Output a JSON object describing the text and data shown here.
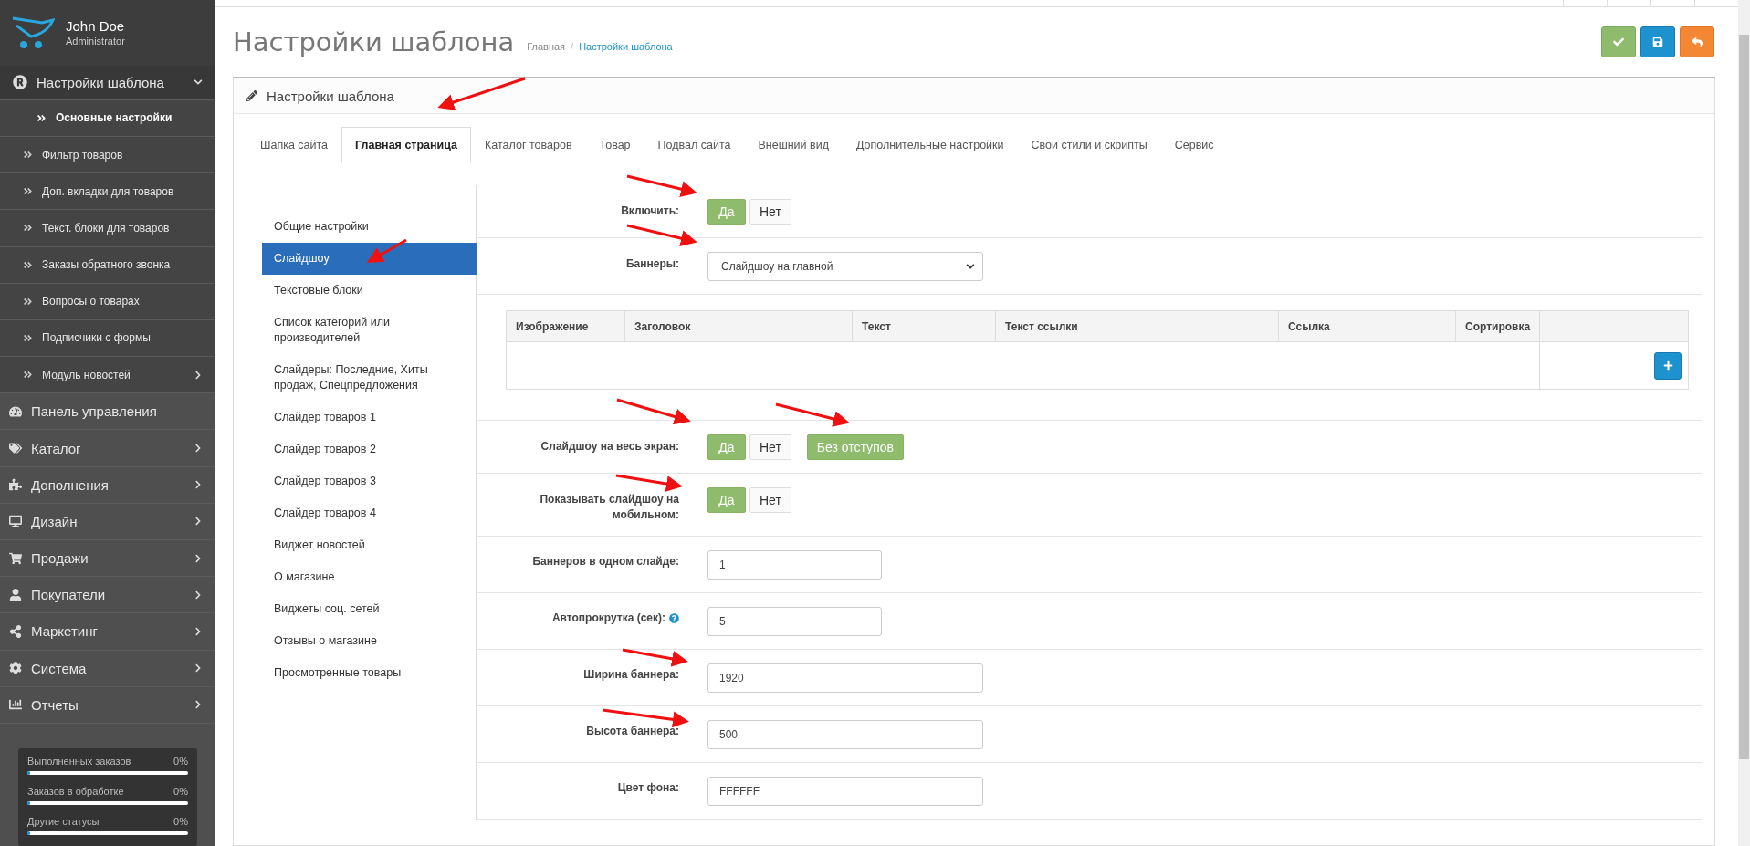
{
  "user": {
    "name": "John Doe",
    "role": "Administrator"
  },
  "sidebar": {
    "items": [
      {
        "label": "Настройки шаблона",
        "expandable": true,
        "expanded": true,
        "children": [
          {
            "label": "Основные настройки",
            "selected": true,
            "expandable": false
          },
          {
            "label": "Фильтр товаров",
            "selected": false,
            "expandable": false
          },
          {
            "label": "Доп. вкладки для товаров",
            "selected": false,
            "expandable": false
          },
          {
            "label": "Текст. блоки для товаров",
            "selected": false,
            "expandable": false
          },
          {
            "label": "Заказы обратного звонка",
            "selected": false,
            "expandable": false
          },
          {
            "label": "Вопросы о товарах",
            "selected": false,
            "expandable": false
          },
          {
            "label": "Подписчики с формы",
            "selected": false,
            "expandable": false
          },
          {
            "label": "Модуль новостей",
            "selected": false,
            "expandable": true
          }
        ]
      },
      {
        "label": "Панель управления",
        "expandable": false,
        "expanded": false
      },
      {
        "label": "Каталог",
        "expandable": true,
        "expanded": false
      },
      {
        "label": "Дополнения",
        "expandable": true,
        "expanded": false
      },
      {
        "label": "Дизайн",
        "expandable": true,
        "expanded": false
      },
      {
        "label": "Продажи",
        "expandable": true,
        "expanded": false
      },
      {
        "label": "Покупатели",
        "expandable": true,
        "expanded": false
      },
      {
        "label": "Маркетинг",
        "expandable": true,
        "expanded": false
      },
      {
        "label": "Система",
        "expandable": true,
        "expanded": false
      },
      {
        "label": "Отчеты",
        "expandable": true,
        "expanded": false
      }
    ]
  },
  "stats": [
    {
      "label": "Выполненных заказов",
      "value": "0%",
      "level": 0
    },
    {
      "label": "Заказов в обработке",
      "value": "0%",
      "level": 0
    },
    {
      "label": "Другие статусы",
      "value": "0%",
      "level": 0
    }
  ],
  "page": {
    "title": "Настройки шаблона",
    "breadcrumb_separator": "/",
    "breadcrumbs": [
      {
        "label": "Главная"
      },
      {
        "label": "Настройки шаблона"
      }
    ]
  },
  "toolbar_buttons": [
    {
      "kind": "apply"
    },
    {
      "kind": "save"
    },
    {
      "kind": "back"
    }
  ],
  "panel": {
    "title": "Настройки шаблона",
    "tabs": [
      {
        "label": "Шапка сайта",
        "selected": false
      },
      {
        "label": "Главная страница",
        "selected": true
      },
      {
        "label": "Каталог товаров",
        "selected": false
      },
      {
        "label": "Товар",
        "selected": false
      },
      {
        "label": "Подвал сайта",
        "selected": false
      },
      {
        "label": "Внешний вид",
        "selected": false
      },
      {
        "label": "Дополнительные настройки",
        "selected": false
      },
      {
        "label": "Свои стили и скрипты",
        "selected": false
      },
      {
        "label": "Сервис",
        "selected": false
      }
    ],
    "subnav": [
      {
        "label": "Общие настройки",
        "selected": false
      },
      {
        "label": "Слайдшоу",
        "selected": true
      },
      {
        "label": "Текстовые блоки",
        "selected": false
      },
      {
        "label": "Список категорий или производителей",
        "selected": false
      },
      {
        "label": "Слайдеры: Последние, Хиты продаж, Спецпредложения",
        "selected": false
      },
      {
        "label": "Слайдер товаров 1",
        "selected": false
      },
      {
        "label": "Слайдер товаров 2",
        "selected": false
      },
      {
        "label": "Слайдер товаров 3",
        "selected": false
      },
      {
        "label": "Слайдер товаров 4",
        "selected": false
      },
      {
        "label": "Виджет новостей",
        "selected": false
      },
      {
        "label": "О магазине",
        "selected": false
      },
      {
        "label": "Виджеты соц. сетей",
        "selected": false
      },
      {
        "label": "Отзывы о магазине",
        "selected": false
      },
      {
        "label": "Просмотренные товары",
        "selected": false
      }
    ],
    "form": [
      {
        "kind": "toggle",
        "label": "Включить:",
        "options": [
          {
            "label": "Да",
            "selected": true
          },
          {
            "label": "Нет",
            "selected": false
          }
        ]
      },
      {
        "kind": "select",
        "label": "Баннеры:",
        "value": "Слайдшоу на главной"
      },
      {
        "kind": "table",
        "columns": [
          "Изображение",
          "Заголовок",
          "Текст",
          "Текст ссылки",
          "Ссылка",
          "Сортировка"
        ]
      },
      {
        "kind": "toggle",
        "label": "Слайдшоу на весь экран:",
        "options": [
          {
            "label": "Да",
            "selected": true
          },
          {
            "label": "Нет",
            "selected": false
          },
          {
            "label": "Без отступов",
            "selected": true
          }
        ]
      },
      {
        "kind": "toggle",
        "label": "Показывать слайдшоу на мобильном:",
        "options": [
          {
            "label": "Да",
            "selected": true
          },
          {
            "label": "Нет",
            "selected": false
          }
        ]
      },
      {
        "kind": "number",
        "label": "Баннеров в одном слайде:",
        "value": "1"
      },
      {
        "kind": "number",
        "label": "Автопрокрутка (сек):",
        "value": "5",
        "help": true
      },
      {
        "kind": "text",
        "label": "Ширина баннера:",
        "value": "1920"
      },
      {
        "kind": "text",
        "label": "Высота баннера:",
        "value": "500"
      },
      {
        "kind": "text",
        "label": "Цвет фона:",
        "value": "FFFFFF"
      }
    ]
  }
}
